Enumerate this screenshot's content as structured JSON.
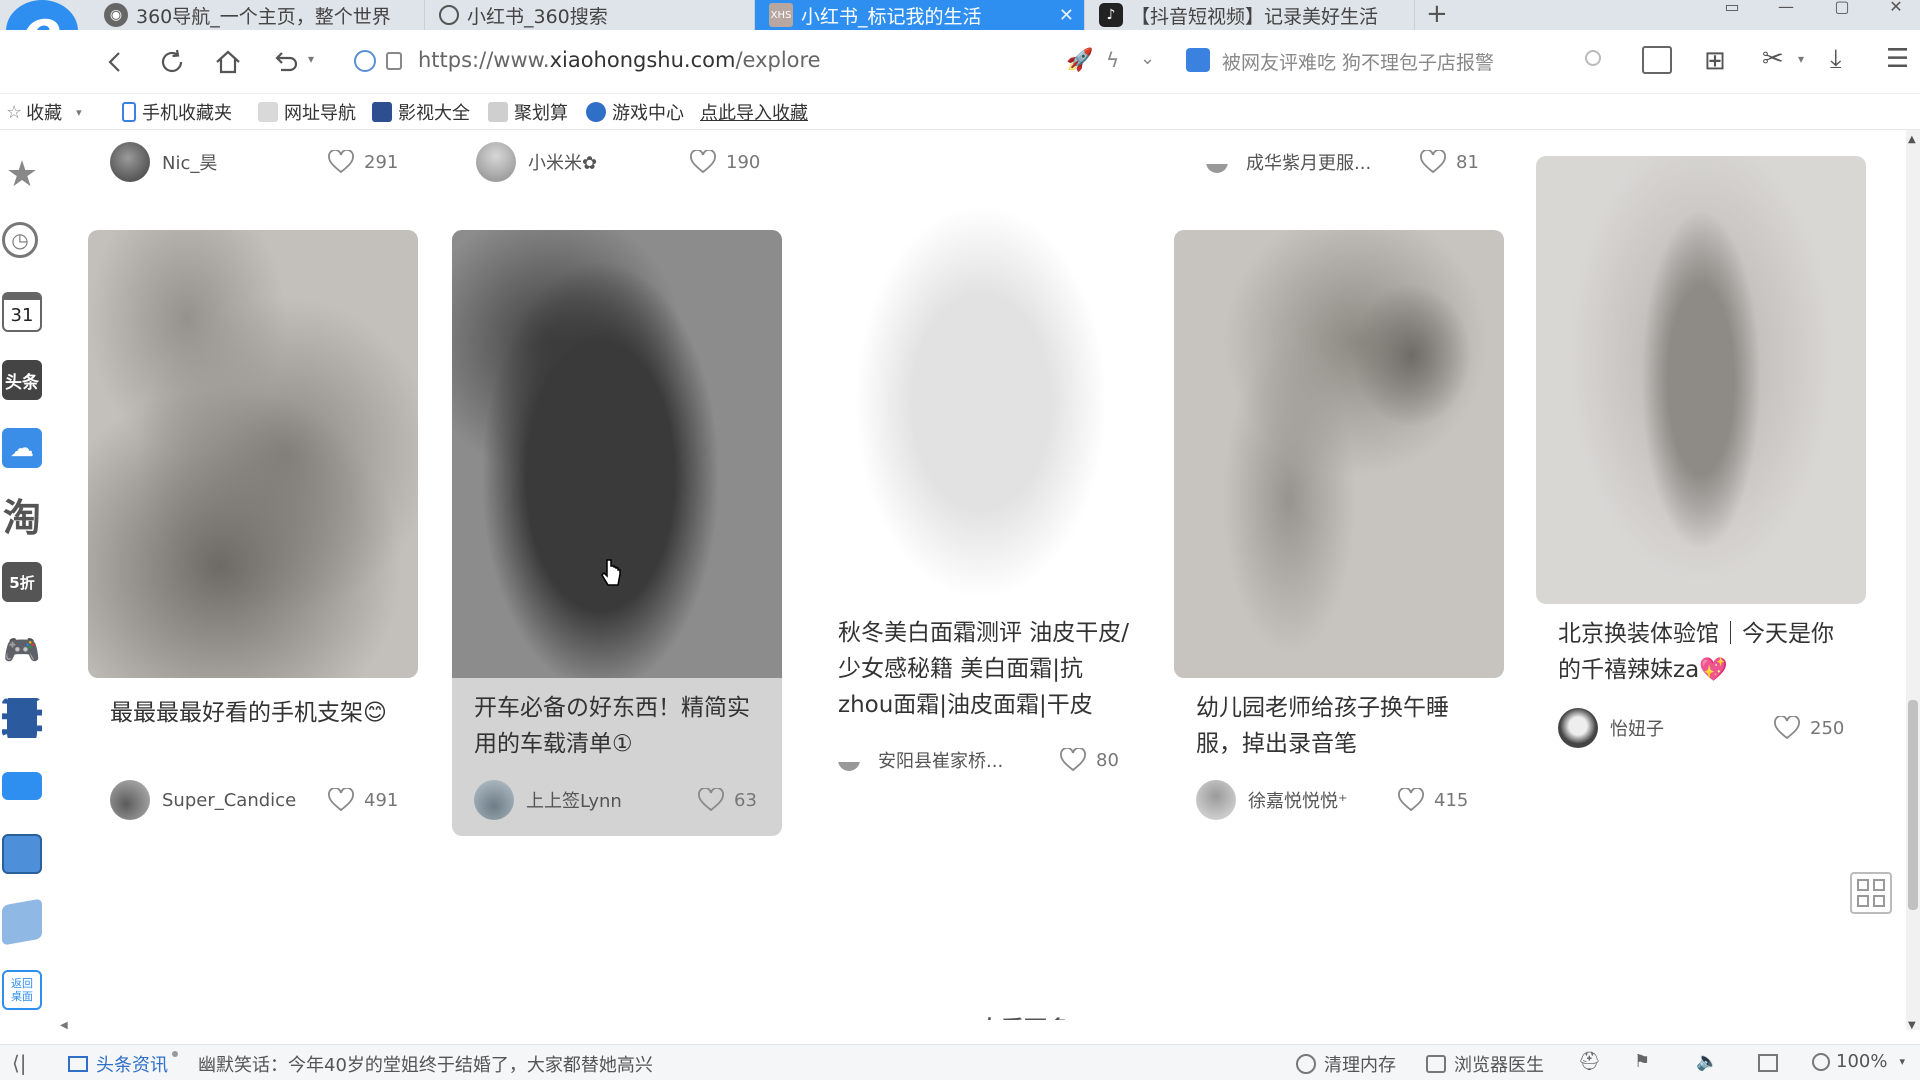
{
  "tabs": [
    {
      "label": "360导航_一个主页，整个世界",
      "icon": "globe-icon"
    },
    {
      "label": "小红书_360搜索",
      "icon": "search-icon"
    },
    {
      "label": "小红书_标记我的生活",
      "icon": "xiaohongshu-icon",
      "active": true
    },
    {
      "label": "【抖音短视频】记录美好生活",
      "icon": "tiktok-icon"
    }
  ],
  "address": {
    "scheme": "https://www.",
    "host": "xiaohongshu.com",
    "path": "/explore",
    "search_hint": "被网友评难吃 狗不理包子店报警"
  },
  "bookmarks": [
    {
      "label": "收藏",
      "icon": "star-icon"
    },
    {
      "label": "手机收藏夹",
      "icon": "phone-icon"
    },
    {
      "label": "网址导航",
      "icon": "nav-icon"
    },
    {
      "label": "影视大全",
      "icon": "video-icon"
    },
    {
      "label": "聚划算",
      "icon": "deal-icon"
    },
    {
      "label": "游戏中心",
      "icon": "game-icon"
    },
    {
      "label": "点此导入收藏",
      "icon": ""
    }
  ],
  "sidebar": {
    "items": [
      "star-icon",
      "clock-icon",
      "calendar-icon",
      "toutiao-icon",
      "cloud-icon",
      "taobao-icon",
      "discount-icon",
      "gamepad-icon",
      "film-icon",
      "monitor-icon",
      "calculator-icon",
      "notebook-icon",
      "desktop-icon"
    ],
    "calendar_day": "31",
    "toutiao_label": "头条",
    "taobao_label": "淘",
    "discount_label": "5折",
    "desktop_label": "返回桌面"
  },
  "top_row": [
    {
      "user": "Nic_昊",
      "likes": "291"
    },
    {
      "user": "小米米✿",
      "likes": "190"
    },
    {
      "user": "成华紫月更服...",
      "likes": "81"
    }
  ],
  "cards": [
    {
      "title": "最最最最好看的手机支架😊",
      "user": "Super_Candice",
      "likes": "491"
    },
    {
      "title": "开车必备の好东西！精简实用的车载清单①",
      "user": "上上签Lynn",
      "likes": "63"
    },
    {
      "title": "秋冬美白面霜测评 油皮干皮/少女感秘籍 美白面霜|抗zhou面霜|油皮面霜|干皮",
      "user": "安阳县崔家桥...",
      "likes": "80"
    },
    {
      "title": "幼儿园老师给孩子换午睡服，掉出录音笔",
      "user": "徐嘉悦悦悦⁺",
      "likes": "415"
    },
    {
      "title": "北京换装体验馆｜今天是你的千禧辣妹za💖",
      "user": "怡妞子",
      "likes": "250"
    }
  ],
  "see_more": "查看更多",
  "status": {
    "news_label": "头条资讯",
    "ticker": "幽默笑话：今年40岁的堂姐终于结婚了，大家都替她高兴",
    "clean_memory": "清理内存",
    "browser_doctor": "浏览器医生",
    "zoom": "100%"
  },
  "colors": {
    "accent": "#2f8ff0",
    "tabbar": "#dfe4ea"
  }
}
